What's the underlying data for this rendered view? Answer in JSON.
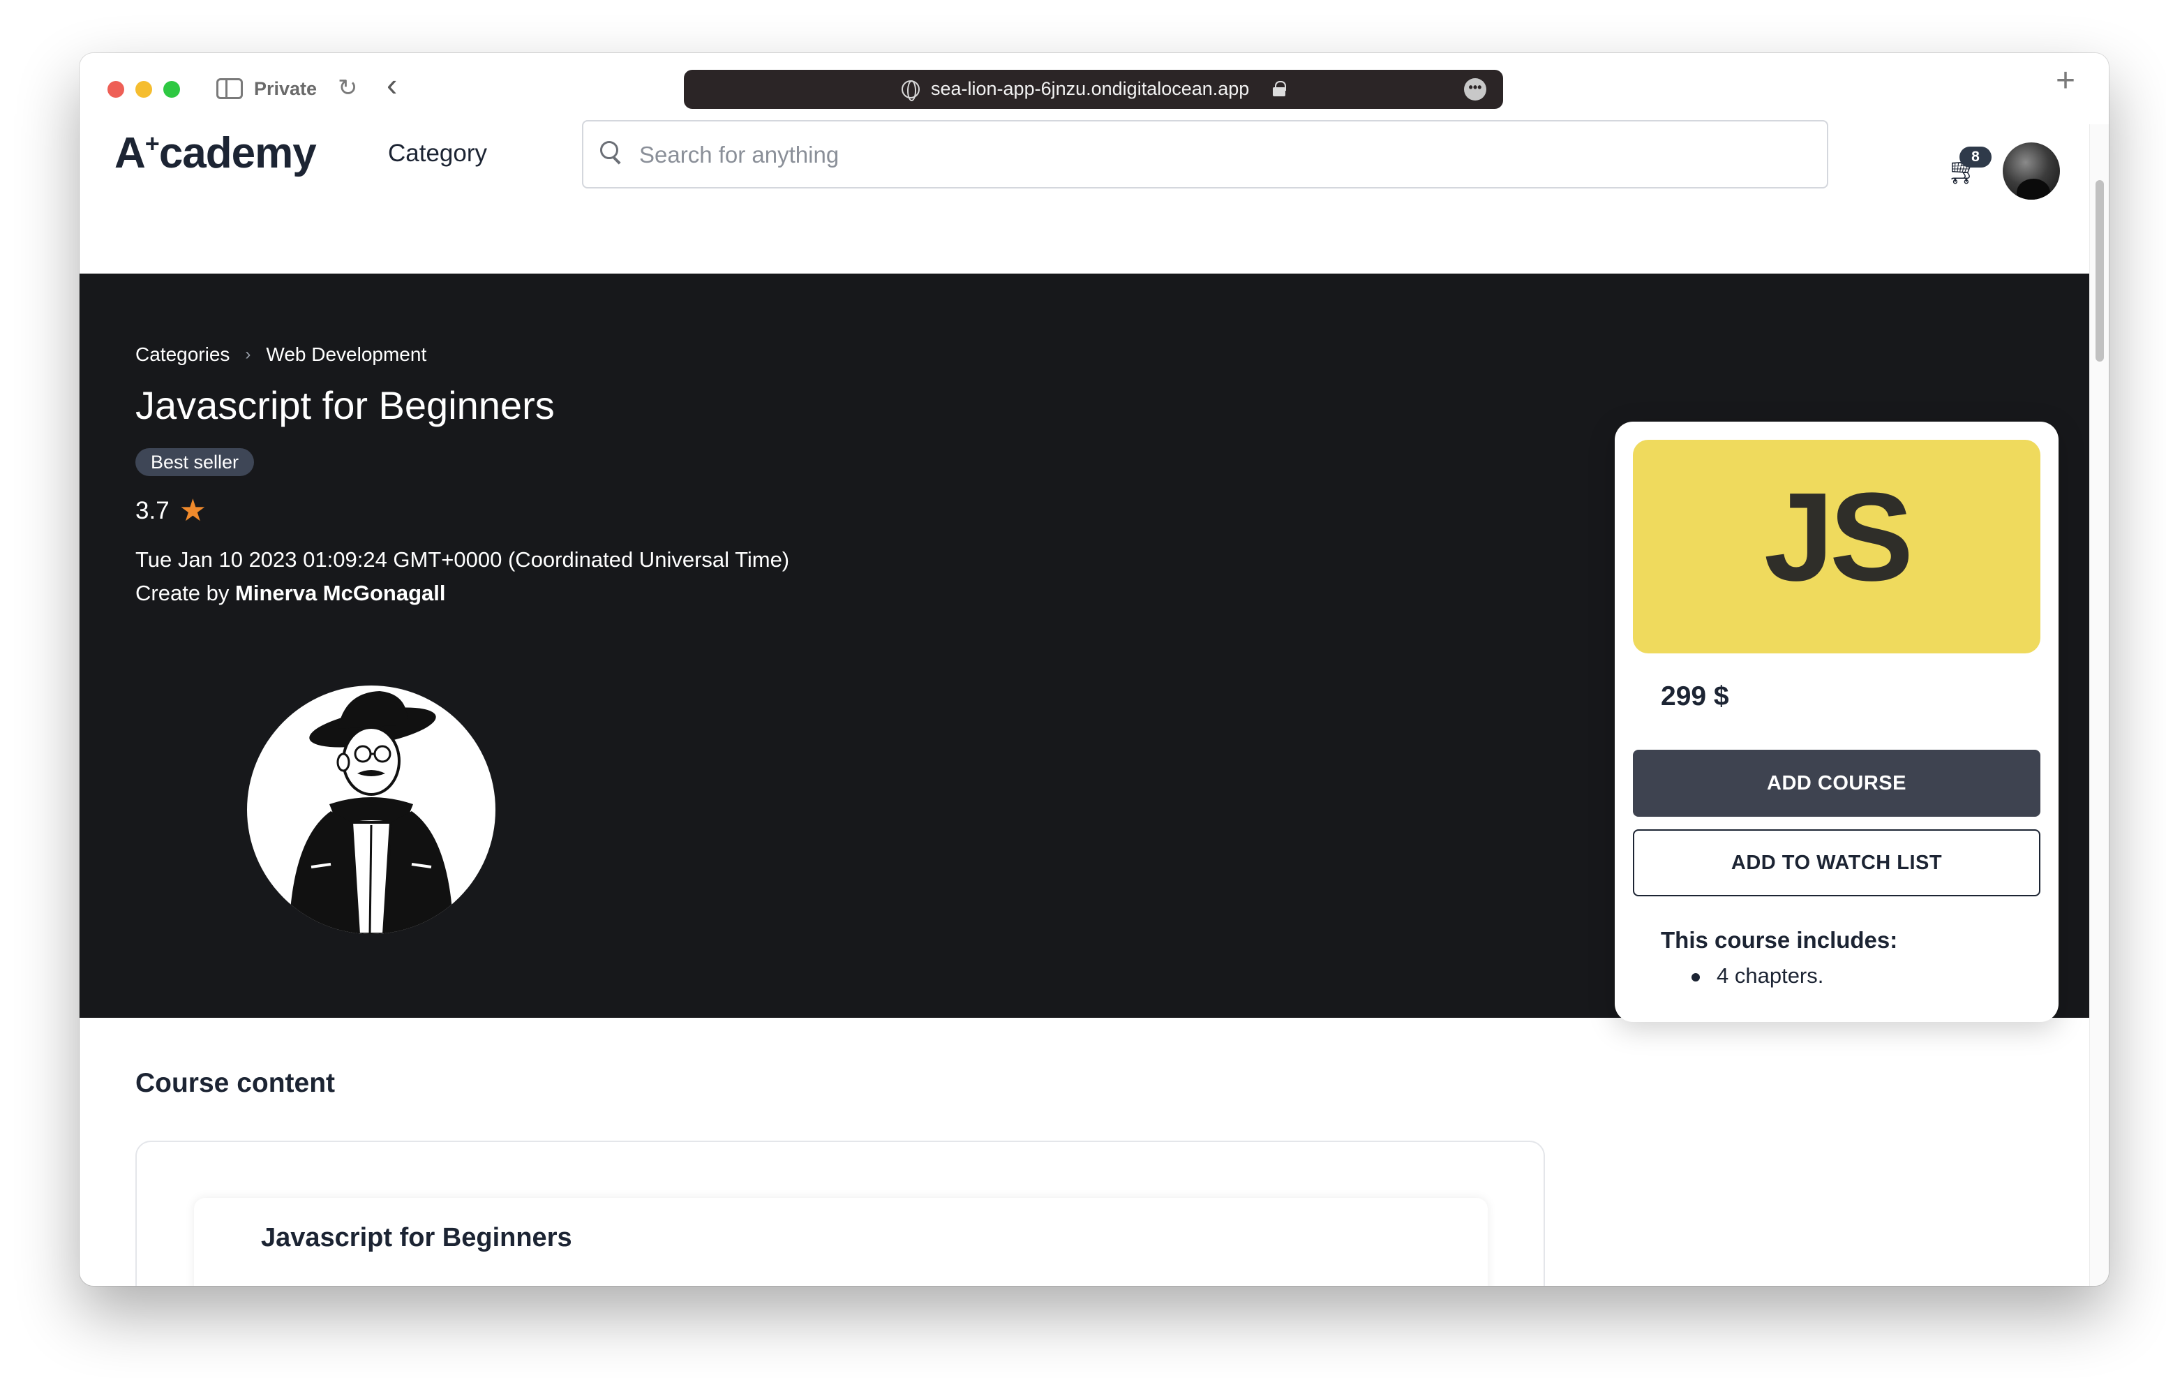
{
  "browser": {
    "private_label": "Private",
    "url": "sea-lion-app-6jnzu.ondigitalocean.app"
  },
  "header": {
    "logo_prefix": "A",
    "logo_sup": "+",
    "logo_suffix": "cademy",
    "category_label": "Category",
    "search_placeholder": "Search for anything",
    "cart_count": "8"
  },
  "hero": {
    "breadcrumb": [
      "Categories",
      "Web Development"
    ],
    "title": "Javascript for Beginners",
    "badge": "Best seller",
    "rating": "3.7",
    "date": "Tue Jan 10 2023 01:09:24 GMT+0000 (Coordinated Universal Time)",
    "creator_prefix": "Create by",
    "creator_name": "Minerva McGonagall"
  },
  "purchase": {
    "thumbnail_text": "JS",
    "price": "299 $",
    "add_course_label": "ADD COURSE",
    "watchlist_label": "ADD TO WATCH LIST",
    "includes_heading": "This course includes:",
    "includes_items": [
      "4 chapters."
    ]
  },
  "content": {
    "heading": "Course content",
    "chapter_title": "Javascript for Beginners"
  },
  "colors": {
    "hero_bg": "#17181b",
    "js_yellow": "#efda5d",
    "primary_button": "#3e4350",
    "star": "#f08a2c"
  }
}
